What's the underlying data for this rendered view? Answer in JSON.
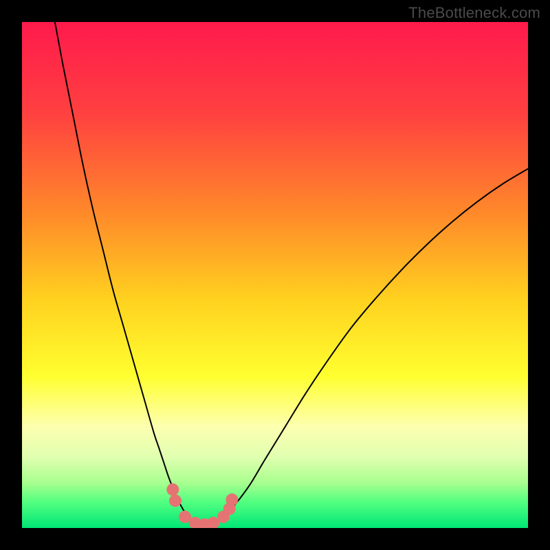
{
  "watermark": "TheBottleneck.com",
  "chart_data": {
    "type": "line",
    "title": "",
    "xlabel": "",
    "ylabel": "",
    "xlim": [
      0,
      100
    ],
    "ylim": [
      0,
      100
    ],
    "grid": false,
    "legend": false,
    "gradient_stops": [
      {
        "offset": 0,
        "color": "#ff1a4c"
      },
      {
        "offset": 18,
        "color": "#ff4040"
      },
      {
        "offset": 38,
        "color": "#ff8a2a"
      },
      {
        "offset": 55,
        "color": "#ffd21f"
      },
      {
        "offset": 70,
        "color": "#ffff30"
      },
      {
        "offset": 80,
        "color": "#fdffb0"
      },
      {
        "offset": 86,
        "color": "#e0ffb0"
      },
      {
        "offset": 91,
        "color": "#a9ff8f"
      },
      {
        "offset": 95,
        "color": "#50ff80"
      },
      {
        "offset": 100,
        "color": "#00e676"
      }
    ],
    "series": [
      {
        "name": "left-curve",
        "color": "#000000",
        "width": 2,
        "x": [
          6.5,
          8,
          10,
          12,
          14,
          16,
          18,
          20,
          22,
          24,
          26,
          27,
          28,
          29,
          30,
          31,
          32,
          33,
          34
        ],
        "y": [
          100,
          92,
          82,
          72,
          63,
          55,
          47,
          40,
          33,
          26,
          19,
          16,
          13,
          10,
          7.5,
          5.2,
          3.4,
          2.0,
          1.1
        ]
      },
      {
        "name": "right-curve",
        "color": "#000000",
        "width": 2,
        "x": [
          38,
          40,
          42,
          45,
          48,
          52,
          56,
          60,
          65,
          70,
          75,
          80,
          85,
          90,
          95,
          100
        ],
        "y": [
          1.1,
          2.4,
          4.5,
          8.5,
          13.5,
          20,
          26.5,
          32.5,
          39.5,
          45.5,
          51,
          56,
          60.5,
          64.5,
          68,
          71
        ]
      },
      {
        "name": "valley-floor",
        "color": "#000000",
        "width": 2,
        "x": [
          34,
          35,
          36,
          37,
          38
        ],
        "y": [
          1.1,
          0.7,
          0.6,
          0.7,
          1.1
        ]
      }
    ],
    "markers": {
      "name": "valley-dots",
      "color": "#e57373",
      "radius": 9,
      "points": [
        {
          "x": 29.8,
          "y": 7.6
        },
        {
          "x": 30.3,
          "y": 5.4
        },
        {
          "x": 32.2,
          "y": 2.2
        },
        {
          "x": 34.2,
          "y": 1.0
        },
        {
          "x": 36.0,
          "y": 0.7
        },
        {
          "x": 37.8,
          "y": 1.0
        },
        {
          "x": 39.8,
          "y": 2.2
        },
        {
          "x": 41.0,
          "y": 3.8
        },
        {
          "x": 41.5,
          "y": 5.6
        }
      ]
    }
  }
}
